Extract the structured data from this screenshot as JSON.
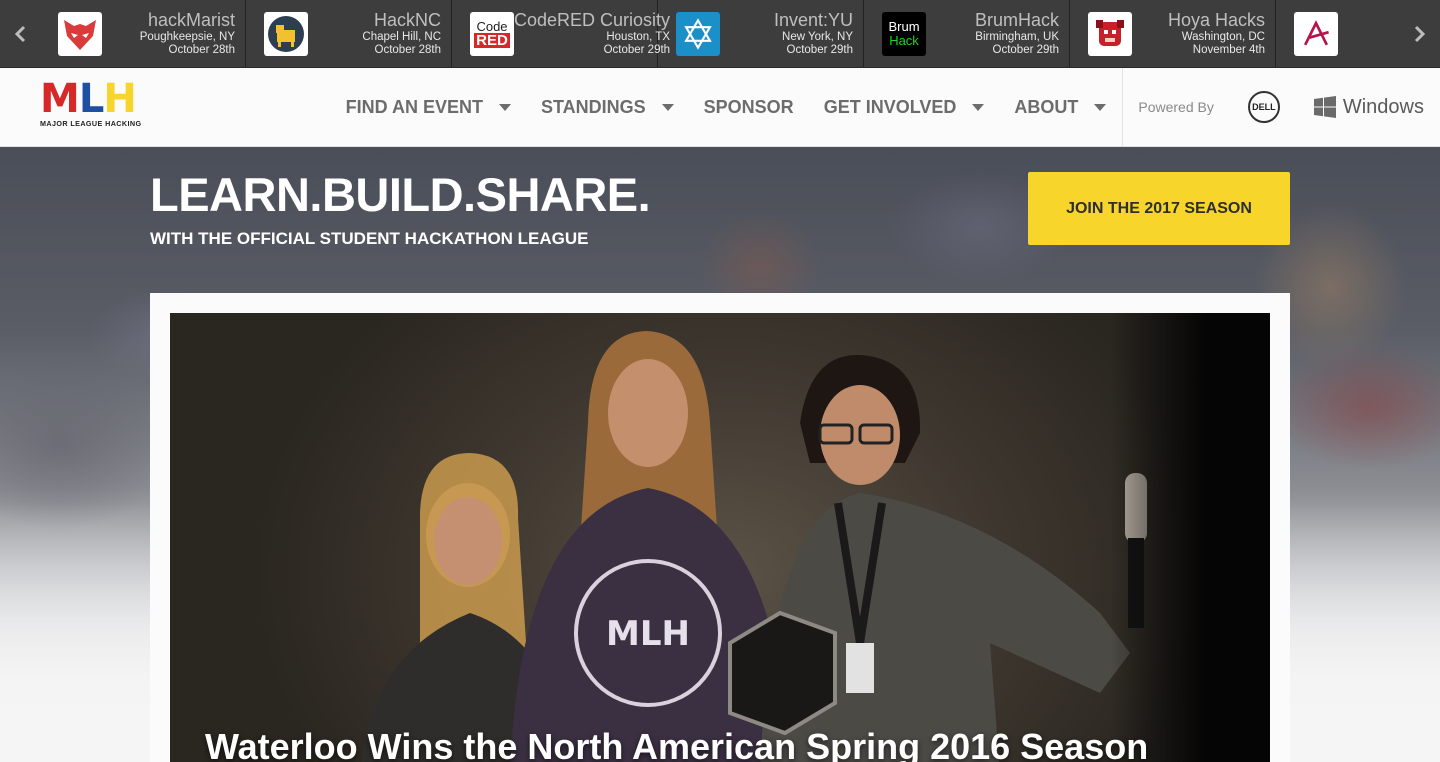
{
  "ticker": {
    "events": [
      {
        "name": "hackMarist",
        "location": "Poughkeepsie, NY",
        "date": "October 28th",
        "logo": "fox-mask-icon",
        "color": "#d93a3a"
      },
      {
        "name": "HackNC",
        "location": "Chapel Hill, NC",
        "date": "October 28th",
        "logo": "ram-icon",
        "color": "#f2c12e"
      },
      {
        "name": "CodeRED Curiosity",
        "location": "Houston, TX",
        "date": "October 29th",
        "logo": "codered-icon",
        "color": "#d62828",
        "logo_text_top": "Code",
        "logo_text_bottom": "RED"
      },
      {
        "name": "Invent:YU",
        "location": "New York, NY",
        "date": "October 29th",
        "logo": "star-of-david-icon",
        "color": "#1b8fc8"
      },
      {
        "name": "BrumHack",
        "location": "Birmingham, UK",
        "date": "October 29th",
        "logo": "brumhack-icon",
        "color": "#1fd61f",
        "logo_text_top": "Brum",
        "logo_text_bottom": "Hack"
      },
      {
        "name": "Hoya Hacks",
        "location": "Washington, DC",
        "date": "November 4th",
        "logo": "bulldog-icon",
        "color": "#c7202a"
      },
      {
        "name": "",
        "location": "",
        "date": "",
        "logo": "a-shape-icon",
        "color": "#b5134a"
      }
    ]
  },
  "nav": {
    "brand": {
      "letters": [
        "M",
        "L",
        "H"
      ],
      "letter_colors": [
        "#d62828",
        "#1d4fa3",
        "#f7d52b"
      ],
      "tagline": "MAJOR LEAGUE HACKING"
    },
    "items": [
      {
        "label": "FIND AN EVENT",
        "dropdown": true
      },
      {
        "label": "STANDINGS",
        "dropdown": true
      },
      {
        "label": "SPONSOR",
        "dropdown": false
      },
      {
        "label": "GET INVOLVED",
        "dropdown": true
      },
      {
        "label": "ABOUT",
        "dropdown": true
      }
    ],
    "powered_label": "Powered By",
    "dell_label": "DELL",
    "windows_label": "Windows"
  },
  "hero": {
    "title": "LEARN.BUILD.SHARE.",
    "subtitle": "WITH THE OFFICIAL STUDENT HACKATHON LEAGUE",
    "cta_label": "JOIN THE 2017 SEASON",
    "accent": "#f7d52b"
  },
  "featured": {
    "title": "Waterloo Wins the North American Spring 2016 Season",
    "shirt_text": "MLH"
  }
}
